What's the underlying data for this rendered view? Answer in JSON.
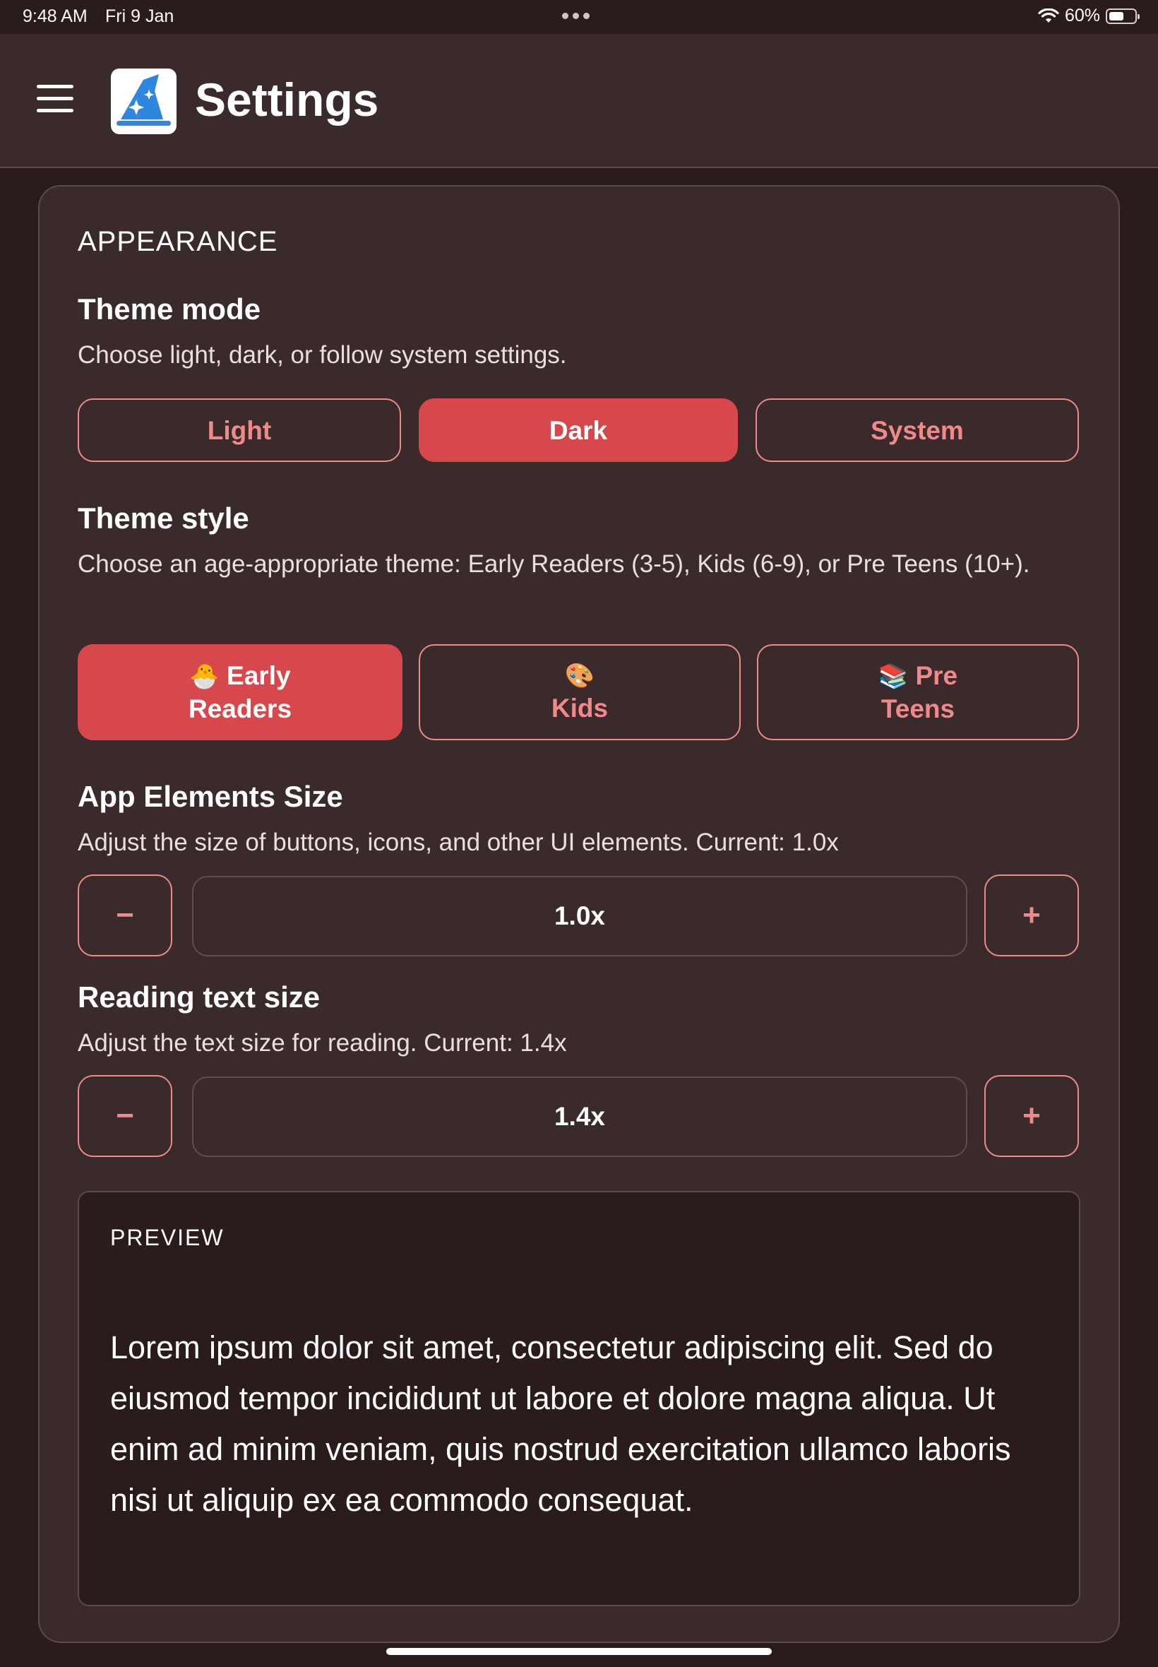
{
  "status_bar": {
    "time": "9:48 AM",
    "date": "Fri 9 Jan",
    "battery_text": "60%",
    "battery_level": 0.6
  },
  "header": {
    "title": "Settings",
    "menu_icon": "hamburger-menu-icon",
    "logo_icon": "wizard-hat-icon"
  },
  "appearance": {
    "section_title": "APPEARANCE",
    "theme_mode": {
      "label": "Theme mode",
      "description": "Choose light, dark, or follow system settings.",
      "options": [
        "Light",
        "Dark",
        "System"
      ],
      "selected": "Dark"
    },
    "theme_style": {
      "label": "Theme style",
      "description": "Choose an age-appropriate theme: Early Readers (3-5), Kids (6-9), or Pre Teens (10+).",
      "options": [
        {
          "emoji": "🐣",
          "label": "Early Readers"
        },
        {
          "emoji": "🎨",
          "label": "Kids"
        },
        {
          "emoji": "📚",
          "label": "Pre Teens"
        }
      ],
      "selected": "Early Readers"
    },
    "app_elements_size": {
      "label": "App Elements Size",
      "description": "Adjust the size of buttons, icons, and other UI elements. Current: 1.0x",
      "decrement": "−",
      "increment": "+",
      "value": "1.0x"
    },
    "reading_text_size": {
      "label": "Reading text size",
      "description": "Adjust the text size for reading. Current: 1.4x",
      "decrement": "−",
      "increment": "+",
      "value": "1.4x"
    },
    "preview": {
      "title": "PREVIEW",
      "text": "Lorem ipsum dolor sit amet, consectetur adipiscing elit. Sed do eiusmod tempor incididunt ut labore et dolore magna aliqua. Ut enim ad minim veniam, quis nostrud exercitation ullamco laboris nisi ut aliquip ex ea commodo consequat."
    }
  },
  "colors": {
    "background": "#2a1c1d",
    "card": "#3a2a2b",
    "accent": "#d6484b",
    "accent_outline": "#f08a8a"
  }
}
